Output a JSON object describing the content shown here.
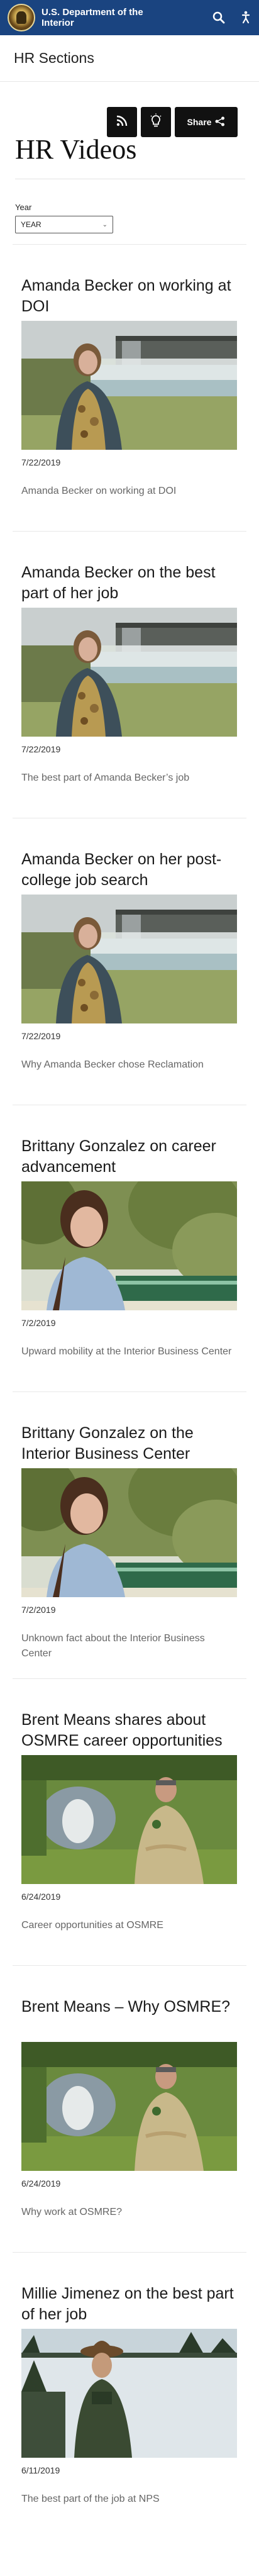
{
  "header": {
    "agency": "U.S. Department of the Interior",
    "icons": [
      "search-icon",
      "accessibility-icon"
    ]
  },
  "section_nav": {
    "label": "HR Sections"
  },
  "share_bar": {
    "share_label": "Share",
    "icons": [
      "rss-icon",
      "lightbulb-icon",
      "share-icon"
    ]
  },
  "page_title": "HR Videos",
  "filter": {
    "label": "Year",
    "selected": "YEAR"
  },
  "videos": [
    {
      "title": "Amanda Becker on working at DOI",
      "date": "7/22/2019",
      "description": "Amanda Becker on working at DOI",
      "scene": "river"
    },
    {
      "title": "Amanda Becker on the best part of her job",
      "date": "7/22/2019",
      "description": "The best part of Amanda Becker’s job",
      "scene": "river"
    },
    {
      "title": "Amanda Becker on her post-college job search",
      "date": "7/22/2019",
      "description": "Why Amanda Becker chose Reclamation",
      "scene": "river"
    },
    {
      "title": "Brittany Gonzalez on career advancement",
      "date": "7/2/2019",
      "description": "Upward mobility at the Interior Business Center",
      "scene": "trees"
    },
    {
      "title": "Brittany Gonzalez on the Interior Business Center",
      "date": "7/2/2019",
      "description": "Unknown fact about the Interior Business Center",
      "scene": "trees"
    },
    {
      "title": "Brent Means shares about OSMRE career opportunities",
      "date": "6/24/2019",
      "description": "Career opportunities at OSMRE",
      "scene": "pond"
    },
    {
      "title": "Brent Means – Why OSMRE?",
      "date": "6/24/2019",
      "description": "Why work at OSMRE?",
      "scene": "pond"
    },
    {
      "title": "Millie Jimenez on the best part of her job",
      "date": "6/11/2019",
      "description": "The best part of the job at NPS",
      "scene": "snow"
    }
  ]
}
